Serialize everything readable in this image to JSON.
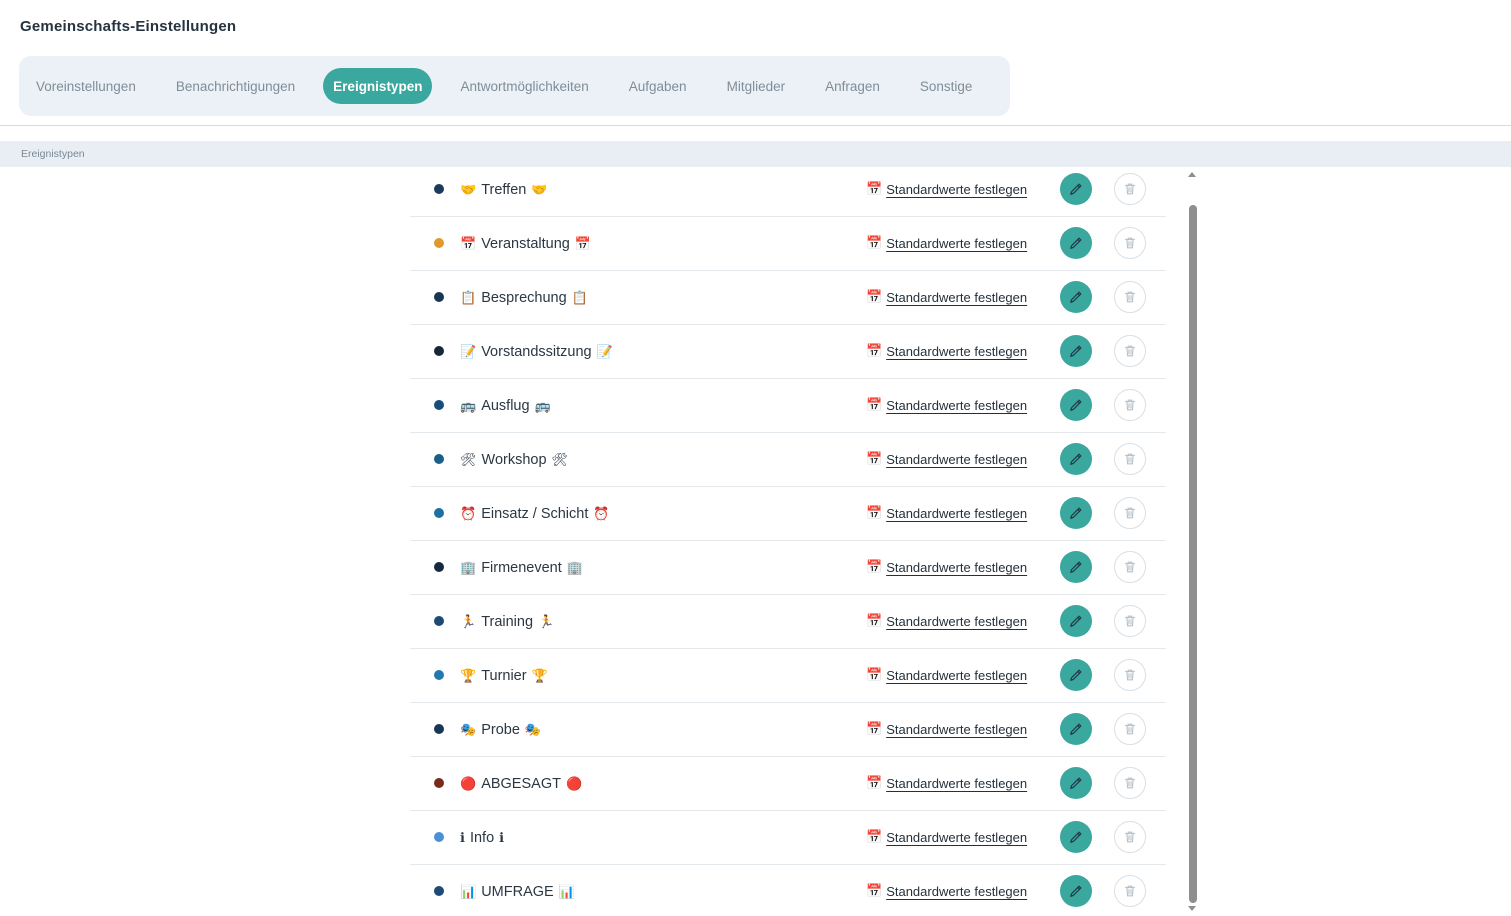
{
  "page": {
    "title": "Gemeinschafts-Einstellungen"
  },
  "tabs": [
    {
      "label": "Voreinstellungen",
      "active": false
    },
    {
      "label": "Benachrichtigungen",
      "active": false
    },
    {
      "label": "Ereignistypen",
      "active": true
    },
    {
      "label": "Antwortmöglichkeiten",
      "active": false
    },
    {
      "label": "Aufgaben",
      "active": false
    },
    {
      "label": "Mitglieder",
      "active": false
    },
    {
      "label": "Anfragen",
      "active": false
    },
    {
      "label": "Sonstige",
      "active": false
    }
  ],
  "section": {
    "title": "Ereignistypen"
  },
  "actions": {
    "defaults_label": "Standardwerte festlegen",
    "defaults_icon": "📅"
  },
  "colors": {
    "accent": "#3aa89e"
  },
  "event_types": [
    {
      "name": "Treffen",
      "emoji": "🤝",
      "color": "#1b3a5c"
    },
    {
      "name": "Veranstaltung",
      "emoji": "📅",
      "color": "#e0992a"
    },
    {
      "name": "Besprechung",
      "emoji": "📋",
      "color": "#183552"
    },
    {
      "name": "Vorstandssitzung",
      "emoji": "📝",
      "color": "#16273a"
    },
    {
      "name": "Ausflug",
      "emoji": "🚌",
      "color": "#174d7a"
    },
    {
      "name": "Workshop",
      "emoji": "🛠",
      "color": "#1a5e8a"
    },
    {
      "name": "Einsatz / Schicht",
      "emoji": "⏰",
      "color": "#1e6fa3"
    },
    {
      "name": "Firmenevent",
      "emoji": "🏢",
      "color": "#162a3f"
    },
    {
      "name": "Training",
      "emoji": "🏃",
      "color": "#1c4a72"
    },
    {
      "name": "Turnier",
      "emoji": "🏆",
      "color": "#2478b0"
    },
    {
      "name": "Probe",
      "emoji": "🎭",
      "color": "#183656"
    },
    {
      "name": "ABGESAGT",
      "emoji": "🔴",
      "color": "#7a2a1a"
    },
    {
      "name": "Info",
      "emoji": "ℹ",
      "color": "#4a90d9"
    },
    {
      "name": "UMFRAGE",
      "emoji": "📊",
      "color": "#1e4a78"
    }
  ]
}
